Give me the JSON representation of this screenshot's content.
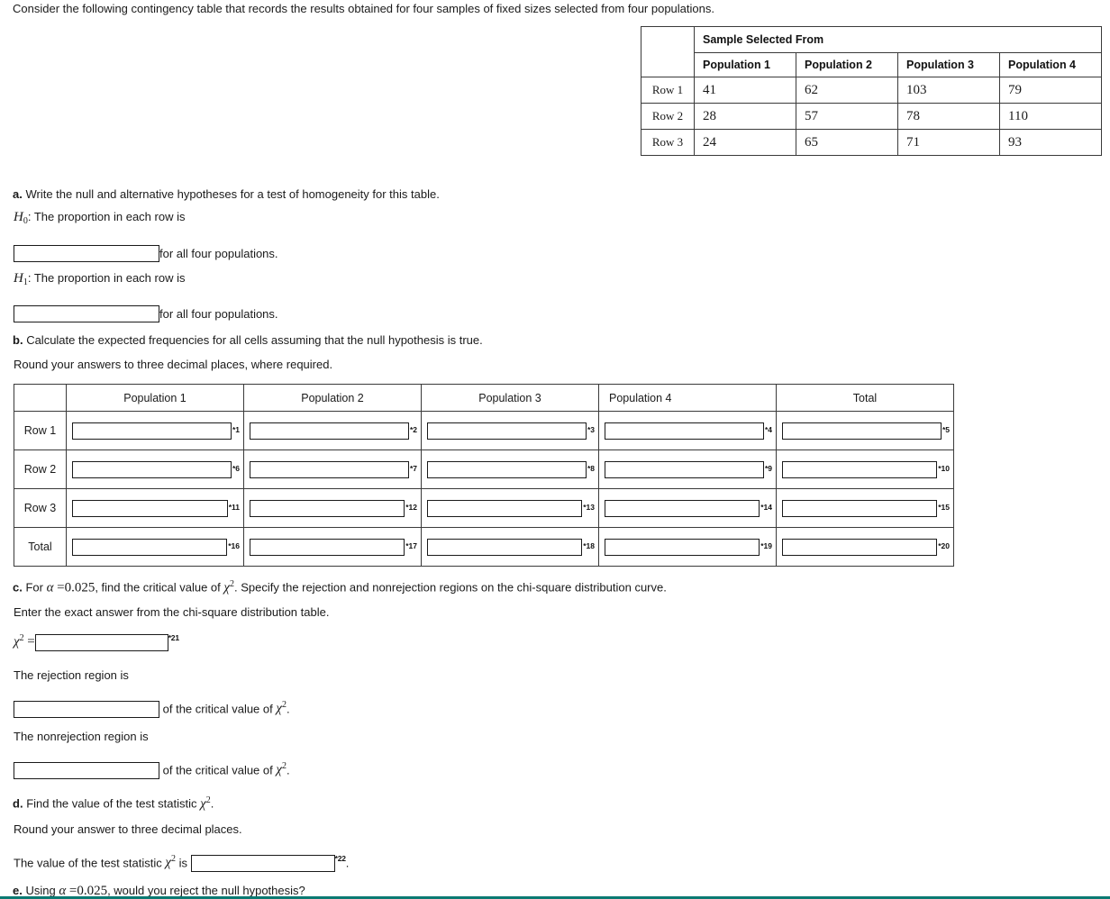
{
  "intro": {
    "text": "Consider the following contingency table that records the results obtained for four samples of fixed sizes selected from four populations."
  },
  "contingency_table": {
    "group_header": "Sample Selected From",
    "column_headers": [
      "Population 1",
      "Population 2",
      "Population 3",
      "Population 4"
    ],
    "rows": [
      {
        "label": "Row 1",
        "values": [
          "41",
          "62",
          "103",
          "79"
        ]
      },
      {
        "label": "Row 2",
        "values": [
          "28",
          "57",
          "78",
          "110"
        ]
      },
      {
        "label": "Row 3",
        "values": [
          "24",
          "65",
          "71",
          "93"
        ]
      }
    ]
  },
  "part_a": {
    "prompt_label": "a.",
    "prompt": "Write the null and alternative hypotheses for a test of homogeneity for this table.",
    "h0_symbol": "H",
    "h0_sub": "0",
    "h0_text": ": The proportion in each row is",
    "h1_symbol": "H",
    "h1_sub": "1",
    "h1_text": ": The proportion in each row is",
    "h0_answer_value": "",
    "h0_trailing": "for all four populations.",
    "h1_answer_value": "",
    "h1_trailing": "for all four populations."
  },
  "part_b": {
    "prompt_label": "b.",
    "prompt": "Calculate the expected frequencies for all cells assuming that the null hypothesis is true.",
    "rounding_note": "Round your answers to three decimal places, where required.",
    "table": {
      "column_headers": [
        "",
        "Population 1",
        "Population 2",
        "Population 3",
        "Population 4",
        "Total"
      ],
      "rows": [
        {
          "label": "Row 1",
          "markers": [
            "*1",
            "*2",
            "*3",
            "*4",
            "*5"
          ],
          "values": [
            "",
            "",
            "",
            "",
            ""
          ]
        },
        {
          "label": "Row 2",
          "markers": [
            "*6",
            "*7",
            "*8",
            "*9",
            "*10"
          ],
          "values": [
            "",
            "",
            "",
            "",
            ""
          ]
        },
        {
          "label": "Row 3",
          "markers": [
            "*11",
            "*12",
            "*13",
            "*14",
            "*15"
          ],
          "values": [
            "",
            "",
            "",
            "",
            ""
          ]
        },
        {
          "label": "Total",
          "markers": [
            "*16",
            "*17",
            "*18",
            "*19",
            "*20"
          ],
          "values": [
            "",
            "",
            "",
            "",
            ""
          ]
        }
      ]
    }
  },
  "part_c": {
    "prompt_label": "c.",
    "prompt_pre": "For",
    "alpha_symbol": "α",
    "equals": "=",
    "alpha_value": "0.025",
    "prompt_mid": ", find the critical value of",
    "chi_symbol": "χ",
    "chi_exp": "2",
    "prompt_post": ". Specify the rejection and nonrejection regions on the chi-square distribution curve.",
    "exact_note": "Enter the exact answer from the chi-square distribution table.",
    "chi_label": "χ",
    "chi_label_exp": "2",
    "chi_equals": "=",
    "chi_marker": "*21",
    "chi_value": "",
    "rejection_label": "The rejection region is",
    "rejection_value": "",
    "rejection_trailing_pre": "of the critical value of",
    "rejection_trailing_chi": "χ",
    "rejection_trailing_exp": "2",
    "rejection_trailing_post": ".",
    "nonrejection_label": "The nonrejection region is",
    "nonrejection_value": "",
    "nonrejection_trailing_pre": "of the critical value of",
    "nonrejection_trailing_chi": "χ",
    "nonrejection_trailing_exp": "2",
    "nonrejection_trailing_post": "."
  },
  "part_d": {
    "prompt_label": "d.",
    "prompt_pre": "Find the value of the test statistic",
    "chi_symbol": "χ",
    "chi_exp": "2",
    "prompt_post": ".",
    "rounding_note": "Round your answer to three decimal places.",
    "statement_pre": "The value of the test statistic",
    "statement_chi": "χ",
    "statement_exp": "2",
    "statement_is": "is",
    "statement_marker": "*22",
    "statement_value": "",
    "statement_period": "."
  },
  "part_e": {
    "prompt_label": "e.",
    "prompt_pre": "Using",
    "alpha_symbol": "α",
    "equals": "=",
    "alpha_value": "0.025",
    "prompt_post": ", would you reject the null hypothesis?"
  },
  "colors": {
    "text": "#1a1a1a",
    "border": "#3a3a3a",
    "box_border": "#1a1a1a",
    "accent_rule": "#0b7a72",
    "background": "#ffffff"
  }
}
